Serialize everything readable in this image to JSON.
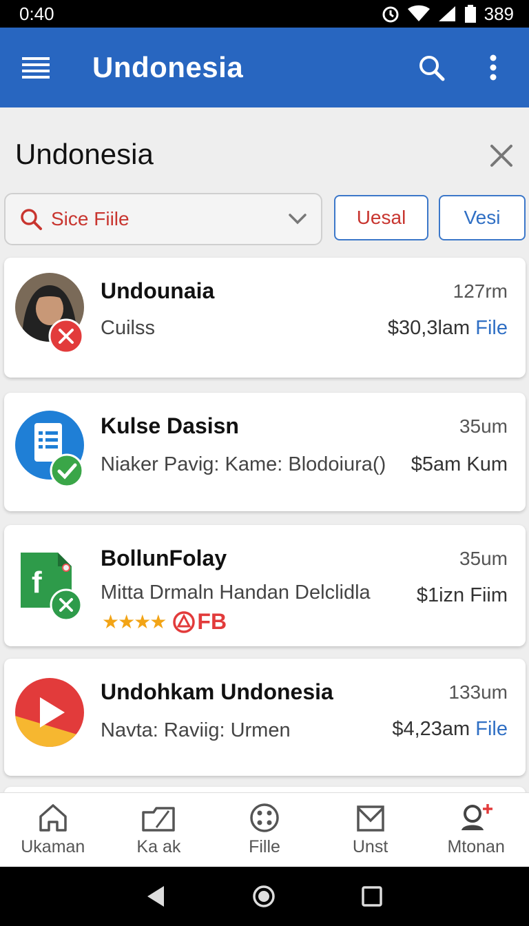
{
  "status_bar": {
    "time": "0:40",
    "battery": "389"
  },
  "app_bar": {
    "title": "Undonesia"
  },
  "page": {
    "title": "Undonesia"
  },
  "filter": {
    "label": "Sice Fiile"
  },
  "chips": [
    "Uesal",
    "Vesi"
  ],
  "items": [
    {
      "name": "Undounaia",
      "time": "127rm",
      "subtitle": "Cuilss",
      "amount": "$30,3lam",
      "amount_link": "File",
      "icon": "profile-photo-icon",
      "badge": "error-x-badge"
    },
    {
      "name": "Kulse Dasisn",
      "time": "35um",
      "subtitle": "Niaker Pavig: Kame: Blodoiura()",
      "amount": "$5am Kum",
      "amount_link": "",
      "icon": "document-icon",
      "badge": "check-badge"
    },
    {
      "name": "BollunFolay",
      "time": "35um",
      "subtitle": "Mitta Drmaln Handan Delclidla",
      "amount": "$1izn Fiim",
      "amount_link": "",
      "rating_badge": "FB",
      "icon": "spreadsheet-icon",
      "badge": "error-x-badge"
    },
    {
      "name": "Undohkam Undonesia",
      "time": "133um",
      "subtitle": "Navta: Raviig: Urmen",
      "amount": "$4,23am",
      "amount_link": "File",
      "icon": "play-icon"
    }
  ],
  "bottom_nav": [
    {
      "label": "Ukaman",
      "icon": "home-icon"
    },
    {
      "label": "Ka ak",
      "icon": "folder-icon"
    },
    {
      "label": "Fille",
      "icon": "grid-dots-icon"
    },
    {
      "label": "Unst",
      "icon": "mail-icon"
    },
    {
      "label": "Mtonan",
      "icon": "account-add-icon"
    }
  ],
  "colors": {
    "primary": "#2866c0",
    "accent_red": "#c8352f",
    "link_blue": "#2f6fc4"
  }
}
